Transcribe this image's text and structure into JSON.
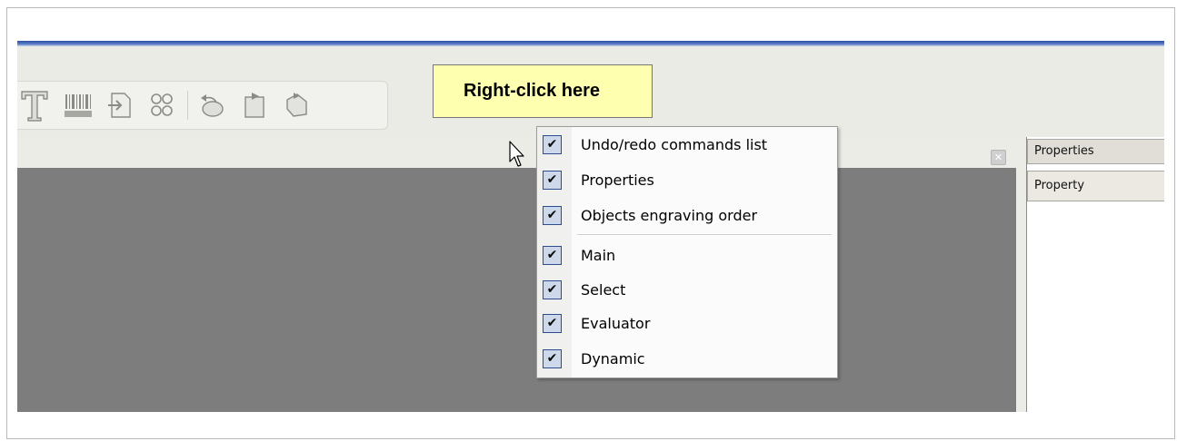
{
  "callout": {
    "text": "Right-click here"
  },
  "toolbar": {
    "icons": [
      "text-tool-icon",
      "barcode-icon",
      "import-icon",
      "links-icon",
      "undo-icon",
      "new-object-icon",
      "tag-icon"
    ]
  },
  "properties_panel": {
    "title": "Properties",
    "column_header": "Property"
  },
  "context_menu": {
    "items": [
      {
        "label": "Undo/redo commands list",
        "checked": true
      },
      {
        "label": "Properties",
        "checked": true
      },
      {
        "label": "Objects engraving order",
        "checked": true
      },
      {
        "label": "Main",
        "checked": true
      },
      {
        "label": "Select",
        "checked": true
      },
      {
        "label": "Evaluator",
        "checked": true
      },
      {
        "label": "Dynamic",
        "checked": true
      }
    ],
    "check_glyph": "✔"
  },
  "colors": {
    "canvas": "#7d7d7d",
    "callout_bg": "#ffffb0",
    "checkbox_fill": "#cdd8ea",
    "title_bar": "#2a4fa6"
  }
}
